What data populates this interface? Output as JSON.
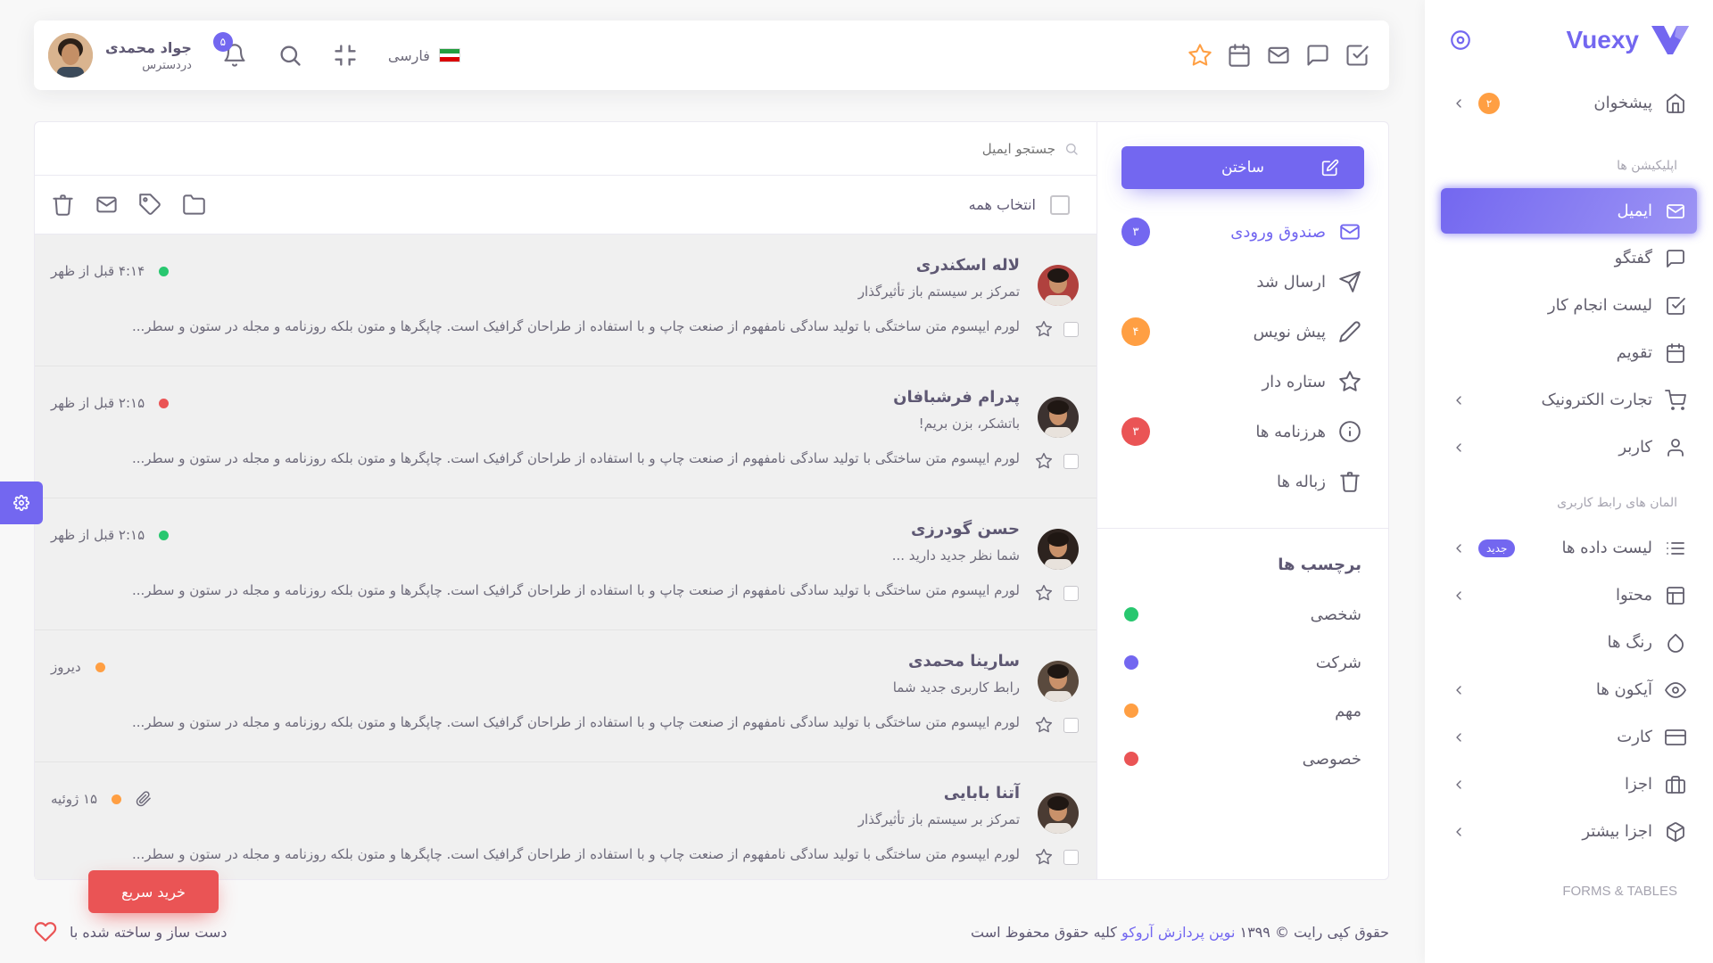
{
  "brand": {
    "name": "Vuexy",
    "color": "#7367f0"
  },
  "sidebar": {
    "items": [
      {
        "label": "پیشخوان",
        "icon": "home-icon",
        "badge": "۲",
        "chevron": true
      },
      {
        "header": "اپلیکیشن ها"
      },
      {
        "label": "ایمیل",
        "icon": "mail-icon",
        "active": true
      },
      {
        "label": "گفتگو",
        "icon": "message-square-icon"
      },
      {
        "label": "لیست انجام کار",
        "icon": "check-square-icon"
      },
      {
        "label": "تقویم",
        "icon": "calendar-icon"
      },
      {
        "label": "تجارت الکترونیک",
        "icon": "shopping-cart-icon",
        "chevron": true
      },
      {
        "label": "کاربر",
        "icon": "user-icon",
        "chevron": true
      },
      {
        "header": "المان های رابط کاربری"
      },
      {
        "label": "لیست داده ها",
        "icon": "list-icon",
        "pill": "جدید",
        "chevron": true
      },
      {
        "label": "محتوا",
        "icon": "layout-icon",
        "chevron": true
      },
      {
        "label": "رنگ ها",
        "icon": "droplet-icon"
      },
      {
        "label": "آیکون ها",
        "icon": "eye-icon",
        "chevron": true
      },
      {
        "label": "کارت",
        "icon": "credit-card-icon",
        "chevron": true
      },
      {
        "label": "اجزا",
        "icon": "briefcase-icon",
        "chevron": true
      },
      {
        "label": "اجزا بیشتر",
        "icon": "box-icon",
        "chevron": true
      },
      {
        "header": "FORMS & TABLES",
        "ltr": true
      }
    ]
  },
  "navbar": {
    "language": "فارسی",
    "notifications_count": "۵",
    "user_name": "جواد محمدی",
    "user_status": "دردسترس",
    "shortcut_icons": [
      "check-square-icon",
      "message-square-icon",
      "mail-icon",
      "calendar-icon",
      "star-icon"
    ]
  },
  "email": {
    "compose_label": "ساختن",
    "search_placeholder": "جستجو ایمیل",
    "select_all_label": "انتخاب همه",
    "folders": [
      {
        "label": "صندوق ورودی",
        "icon": "mail-icon",
        "badge": "۳",
        "badge_color": "#7367f0",
        "active": true
      },
      {
        "label": "ارسال شد",
        "icon": "send-icon"
      },
      {
        "label": "پیش نویس",
        "icon": "edit-pen-icon",
        "badge": "۴",
        "badge_color": "#ff9f43"
      },
      {
        "label": "ستاره دار",
        "icon": "star-icon"
      },
      {
        "label": "هرزنامه ها",
        "icon": "info-icon",
        "badge": "۳",
        "badge_color": "#ea5455"
      },
      {
        "label": "زباله ها",
        "icon": "trash-icon"
      }
    ],
    "labels_title": "برچسب ها",
    "labels": [
      {
        "label": "شخصی",
        "color": "#28c76f"
      },
      {
        "label": "شرکت",
        "color": "#7367f0"
      },
      {
        "label": "مهم",
        "color": "#ff9f43"
      },
      {
        "label": "خصوصی",
        "color": "#ea5455"
      }
    ],
    "messages": [
      {
        "name": "لاله اسکندری",
        "subject": "تمرکز بر سیستم باز تأثیرگذار",
        "excerpt": "لورم ایپسوم متن ساختگی با تولید سادگی نامفهوم از صنعت چاپ و با استفاده از طراحان گرافیک است. چاپگرها و متون بلکه روزنامه و مجله در ستون و سطر...",
        "time": "۴:۱۴ قبل از ظهر",
        "dot_color": "#28c76f",
        "attachment": false,
        "avatar_bg": "#b0413e"
      },
      {
        "name": "پدرام فرشبافان",
        "subject": "باتشکر، بزن بریم!",
        "excerpt": "لورم ایپسوم متن ساختگی با تولید سادگی نامفهوم از صنعت چاپ و با استفاده از طراحان گرافیک است. چاپگرها و متون بلکه روزنامه و مجله در ستون و سطر...",
        "time": "۲:۱۵ قبل از ظهر",
        "dot_color": "#ea5455",
        "attachment": false,
        "avatar_bg": "#3c3230"
      },
      {
        "name": "حسن گودرزی",
        "subject": "شما نظر جدید دارید ...",
        "excerpt": "لورم ایپسوم متن ساختگی با تولید سادگی نامفهوم از صنعت چاپ و با استفاده از طراحان گرافیک است. چاپگرها و متون بلکه روزنامه و مجله در ستون و سطر...",
        "time": "۲:۱۵ قبل از ظهر",
        "dot_color": "#28c76f",
        "attachment": false,
        "avatar_bg": "#2d231f"
      },
      {
        "name": "سارینا محمدی",
        "subject": "رابط کاربری جدید شما",
        "excerpt": "لورم ایپسوم متن ساختگی با تولید سادگی نامفهوم از صنعت چاپ و با استفاده از طراحان گرافیک است. چاپگرها و متون بلکه روزنامه و مجله در ستون و سطر...",
        "time": "دیروز",
        "dot_color": "#ff9f43",
        "attachment": false,
        "avatar_bg": "#5a4a3e"
      },
      {
        "name": "آتنا بابایی",
        "subject": "تمرکز بر سیستم باز تأثیرگذار",
        "excerpt": "لورم ایپسوم متن ساختگی با تولید سادگی نامفهوم از صنعت چاپ و با استفاده از طراحان گرافیک است. چاپگرها و متون بلکه روزنامه و مجله در ستون و سطر...",
        "time": "۱۵ ژوئیه",
        "dot_color": "#ff9f43",
        "attachment": true,
        "avatar_bg": "#4a3b33"
      }
    ]
  },
  "footer": {
    "copyright_prefix": "حقوق کپی رایت © ۱۳۹۹",
    "company": "نوین پردازش آروکو",
    "copyright_suffix": "کلیه حقوق محفوظ است",
    "made_with": "دست ساز و ساخته شده با"
  },
  "buy_now_label": "خرید سریع"
}
